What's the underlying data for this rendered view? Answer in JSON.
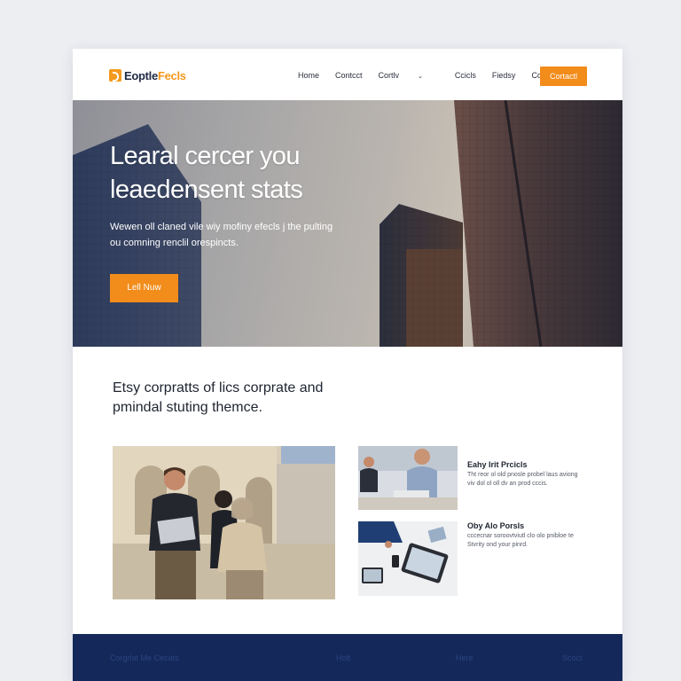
{
  "header": {
    "logo_text_dark": "Eoptle",
    "logo_text_accent": "Fecls",
    "nav": [
      "Home",
      "Contcct",
      "Cortlv",
      "Ccicls",
      "Fiedsy",
      "Corcler"
    ],
    "cta_label": "Cortactl"
  },
  "hero": {
    "title": "Learal cercer you leaedensent stats",
    "subtitle": "Wewen oll claned vile wiy mofiny efecls j the pulting ou comning renclil orespincts.",
    "button_label": "Lell Nuw"
  },
  "intro": {
    "text": "Etsy corpratts of lics corprate and pmindal stuting themce."
  },
  "side_items": [
    {
      "title": "Eahy Irit Prcicls",
      "text": "Tht reor ol old pnosle probel laus aviong viv dol ol oll dv an prod cccis."
    },
    {
      "title": "Oby Alo Porsls",
      "text": "cccecnar soroovtviutl clo olo pnibloe te Stvrity ond your pinrd."
    }
  ],
  "footer": {
    "links": [
      "Corgrlat Me Cecats",
      "Holt",
      "Here",
      "Scoct"
    ]
  },
  "colors": {
    "accent": "#f28c1a",
    "footer_bg": "#14285a",
    "text_dark": "#1f2430"
  }
}
